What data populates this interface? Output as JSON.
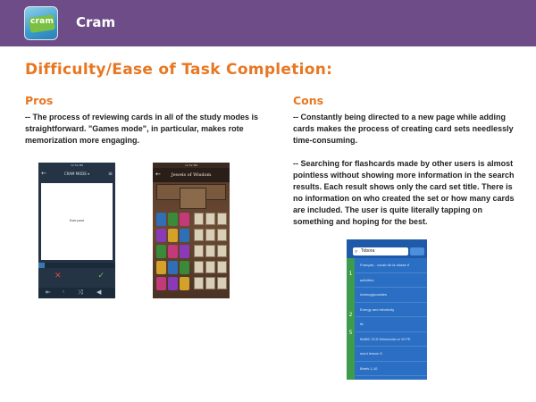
{
  "header": {
    "app_name": "Cram",
    "logo_text": "cram",
    "background_color": "#6d4c87"
  },
  "main": {
    "section_title": "Difficulty/Ease of Task Completion:",
    "accent_color": "#e87722",
    "pros": {
      "heading": "Pros",
      "text": "-- The process of reviewing cards in all of the study modes is straightforward. \"Games mode\", in particular, makes rote memorization more engaging."
    },
    "cons": {
      "heading": "Cons",
      "text_1": "-- Constantly being directed to a new page while adding cards makes the process of creating card sets needlessly time-consuming.",
      "text_2": "-- Searching for flashcards made by other users is almost pointless without showing more information in the search results. Each result shows only the card set title. There is no information on who created the set or how many cards are included. The user is quite literally tapping on something and hoping for the best."
    }
  },
  "screens": {
    "study_mode": {
      "status_time": "12:52 PM",
      "mode_title": "CRAM MODE ▾",
      "card_word": "Everyone",
      "progress_fraction": 0.08,
      "wrong_icon": "x-icon",
      "right_icon": "check-icon"
    },
    "game_mode": {
      "status_time": "12:52 PM",
      "title": "Jewels of Wisdom",
      "tile_colors": [
        "#2e6fb8",
        "#3a8a3a",
        "#c23a7a",
        "#8a3ab8",
        "#d4a12a"
      ]
    },
    "search": {
      "query": "Tobora",
      "side_numbers": [
        "1",
        "2",
        "5"
      ],
      "results": [
        "Français - vocab de la classe 9",
        "activities",
        "Aminoglycosides",
        "Energy and electricity",
        "ifc",
        "MABC 2CS Minnesota cc W PE",
        "word lesson 5",
        "Briefs 1-10"
      ]
    }
  }
}
